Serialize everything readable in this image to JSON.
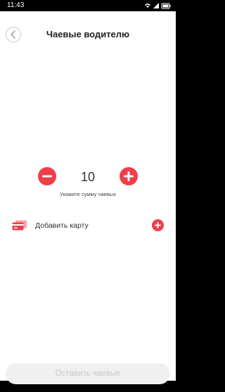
{
  "status_bar": {
    "time": "11:43"
  },
  "header": {
    "title": "Чаевые водителю",
    "back_icon": "chevron-left-icon"
  },
  "tip": {
    "amount": "10",
    "hint": "Укажите сумму чаевых",
    "decrement_icon": "minus-icon",
    "increment_icon": "plus-icon"
  },
  "payment": {
    "add_card_label": "Добавить карту",
    "card_icon": "credit-card-icon",
    "add_icon": "plus-icon"
  },
  "footer": {
    "submit_label": "Оставить чаевые",
    "submit_enabled": false
  },
  "colors": {
    "accent": "#ef3e4a",
    "disabled_bg": "#f0f0f0",
    "disabled_text": "#c8c8c8"
  }
}
